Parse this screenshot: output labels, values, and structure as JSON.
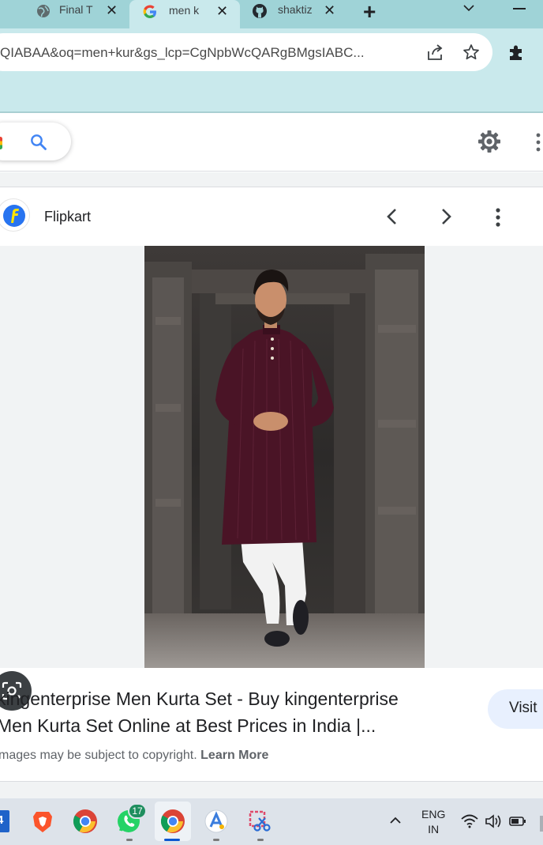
{
  "tabs": [
    {
      "label": "Final T",
      "icon": "globe-icon",
      "active": false
    },
    {
      "label": "men k",
      "icon": "google-icon",
      "active": true
    },
    {
      "label": "shaktiz",
      "icon": "github-icon",
      "active": false
    }
  ],
  "toolbar": {
    "url": "QIABAA&oq=men+kur&gs_lcp=CgNpbWcQARgBMgsIABC...",
    "new_tab_symbol": "+"
  },
  "panel": {
    "source_name": "Flipkart",
    "title_line1": "kingenterprise Men Kurta Set - Buy kingenterprise",
    "title_line2": "Men Kurta Set Online at Best Prices in India |...",
    "visit_label": "Visit",
    "copyright_text": "mages may be subject to copyright.",
    "learn_more": "Learn More"
  },
  "taskbar": {
    "whatsapp_badge": "17",
    "lang_line1": "ENG",
    "lang_line2": "IN"
  },
  "colors": {
    "tabbar": "#9fd3d7",
    "toolbar": "#c9e9ec",
    "google_blue": "#4285f4",
    "visit_bg": "#e8f0fe",
    "kurta": "#4a1426"
  }
}
